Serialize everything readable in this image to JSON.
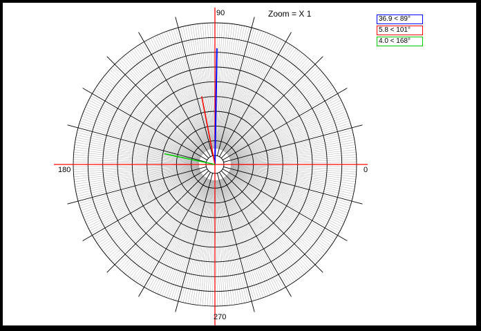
{
  "zoom_text": "Zoom = X 1",
  "axis_labels": {
    "deg90": "90",
    "deg180": "180",
    "deg0": "0",
    "deg270": "270"
  },
  "legend": [
    {
      "text": "36.9 < 89°",
      "color": "#0000ff"
    },
    {
      "text": "5.8 < 101°",
      "color": "#ff0000"
    },
    {
      "text": "4.0 < 168°",
      "color": "#00cc00"
    }
  ],
  "chart_data": {
    "type": "polar",
    "title": "",
    "angular_ticks_deg": [
      0,
      90,
      180,
      270
    ],
    "radial_range": [
      0,
      45
    ],
    "grid": true,
    "vectors": [
      {
        "magnitude": 36.9,
        "angle_deg": 89,
        "color": "#0000ff"
      },
      {
        "magnitude": 5.8,
        "angle_deg": 101,
        "color": "#ff0000"
      },
      {
        "magnitude": 4.0,
        "angle_deg": 168,
        "color": "#00cc00"
      }
    ],
    "axis_colors": {
      "horizontal": "#ff0000",
      "vertical": "#ff0000"
    }
  }
}
